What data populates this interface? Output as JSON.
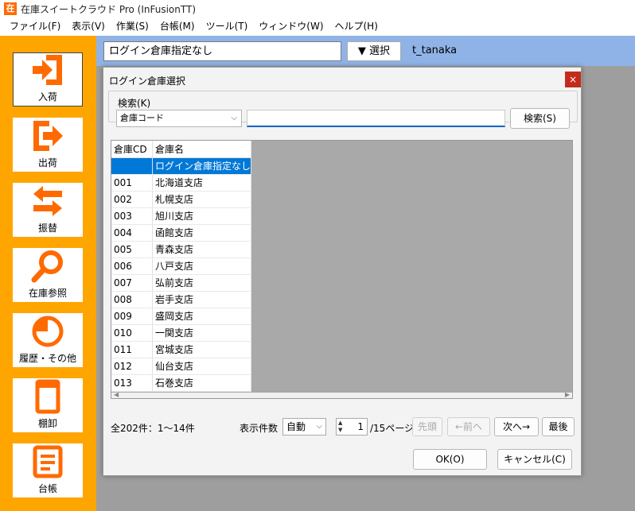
{
  "window": {
    "title": "在庫スイートクラウド Pro (InFusionTT)",
    "icon_char": "在"
  },
  "menu": [
    "ファイル(F)",
    "表示(V)",
    "作業(S)",
    "台帳(M)",
    "ツール(T)",
    "ウィンドウ(W)",
    "ヘルプ(H)"
  ],
  "sidebar": {
    "accent_color": "#ff6a00",
    "items": [
      {
        "label": "入荷",
        "icon": "inbound-icon",
        "active": true
      },
      {
        "label": "出荷",
        "icon": "outbound-icon"
      },
      {
        "label": "振替",
        "icon": "transfer-icon"
      },
      {
        "label": "在庫参照",
        "icon": "search-icon"
      },
      {
        "label": "履歴・その他",
        "icon": "history-icon"
      },
      {
        "label": "棚卸",
        "icon": "stocktake-icon"
      },
      {
        "label": "台帳",
        "icon": "ledger-icon"
      }
    ]
  },
  "topbar": {
    "warehouse_value": "ログイン倉庫指定なし",
    "select_button": "▼ 選択",
    "user": "t_tanaka"
  },
  "dialog": {
    "title": "ログイン倉庫選択",
    "close": "×",
    "search": {
      "group_label": "検索(K)",
      "field_selected": "倉庫コード",
      "input_value": "",
      "button": "検索(S)"
    },
    "table": {
      "columns": [
        "倉庫CD",
        "倉庫名"
      ],
      "rows": [
        [
          "",
          "ログイン倉庫指定なし"
        ],
        [
          "001",
          "北海道支店"
        ],
        [
          "002",
          "札幌支店"
        ],
        [
          "003",
          "旭川支店"
        ],
        [
          "004",
          "函館支店"
        ],
        [
          "005",
          "青森支店"
        ],
        [
          "006",
          "八戸支店"
        ],
        [
          "007",
          "弘前支店"
        ],
        [
          "008",
          "岩手支店"
        ],
        [
          "009",
          "盛岡支店"
        ],
        [
          "010",
          "一関支店"
        ],
        [
          "011",
          "宮城支店"
        ],
        [
          "012",
          "仙台支店"
        ],
        [
          "013",
          "石巻支店"
        ]
      ],
      "selected_row": 0
    },
    "paging": {
      "total_label": "全202件：1～14件",
      "page_size_label": "表示件数",
      "page_size_value": "自動",
      "current_page": "1",
      "page_count_label": "/15ページ",
      "first": "先頭",
      "prev": "←前へ",
      "next": "次へ→",
      "last": "最後"
    },
    "ok": "OK(O)",
    "cancel": "キャンセル(C)"
  }
}
